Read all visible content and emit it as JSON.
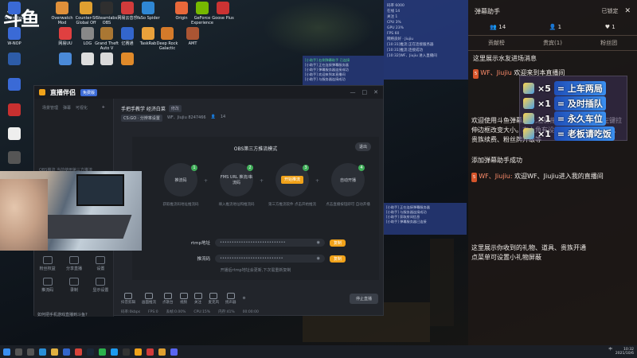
{
  "logo": "斗鱼",
  "desktop_icons": [
    {
      "label": "Unlimited",
      "color": "#3a6ad6"
    },
    {
      "label": "Overwatch Mod",
      "color": "#e0903a"
    },
    {
      "label": "Counter-St Global Off",
      "color": "#e0a030"
    },
    {
      "label": "Steamlabs OBS",
      "color": "#2f2f2f"
    },
    {
      "label": "网易云音乐",
      "color": "#d23b3b"
    },
    {
      "label": "YaSo Spider",
      "color": "#2f87d4"
    },
    {
      "label": "Origin",
      "color": "#e8683a"
    },
    {
      "label": "GeForce Experience",
      "color": "#76b900"
    },
    {
      "label": "Goose Plus",
      "color": "#c33"
    },
    {
      "label": "WEGAME",
      "color": "#2d5ca8"
    },
    {
      "label": "W-NOP",
      "color": "#3a6ad6"
    },
    {
      "label": "网易UU",
      "color": "#e04040"
    },
    {
      "label": "LOG",
      "color": "#888"
    },
    {
      "label": "Grand Theft Auto V",
      "color": "#aa7733"
    },
    {
      "label": "亿赛通",
      "color": "#3366cc"
    },
    {
      "label": "TaskRab",
      "color": "#e9a13b"
    },
    {
      "label": "Deep Rock Galactic",
      "color": "#d47a2a"
    },
    {
      "label": "AMT",
      "color": "#aa5533"
    }
  ],
  "app": {
    "title": "直播伴侣",
    "badge": "免费版",
    "win_controls": [
      "—",
      "□",
      "✕"
    ],
    "left_tabs": [
      "场景管理",
      "弹幕",
      "可视化"
    ],
    "left_plus": "+",
    "left_empty": "OBS推流 当前使用第三方推流",
    "left_grid": [
      "粉丝权益",
      "分享直播",
      "设置",
      "推流码",
      "录制",
      "显示设置",
      "弹幕助手",
      "连麦",
      "任务"
    ],
    "left_note": "如何把手机游戏直播到斗鱼?",
    "stream_title": "手把手教学 经济白菜",
    "stream_edit": "修改",
    "stream_cat": "CS:GO · 分辨率设置",
    "stream_author": "WF、Jiujiu 8247466",
    "stream_viewers": "14",
    "mode_title": "OBS第三方推流模式",
    "exit": "退出",
    "steps": [
      {
        "num": "1",
        "label": "推流码",
        "cap": "获取推流码地址推流码"
      },
      {
        "num": "2",
        "label": "FMS URL 推流/串流码",
        "cap": "填入推流地址和推流码"
      },
      {
        "num": "3",
        "label": "开始推流",
        "cap": "第三方推流软件 点击开始推流"
      },
      {
        "num": "4",
        "label": "自动开播",
        "cap": "点击直播按钮即可 自动开播"
      }
    ],
    "rtmp_label": "rtmp地址",
    "rtmp_value": "••••••••••••••••••••••••••••",
    "key_label": "推流码",
    "key_value": "•••••••••••••••••••••••••••",
    "copy": "复制",
    "hint": "开播后rtmp地址会更新,下次需重新复制",
    "toolbar": [
      "抖音剪辑",
      "画面推流",
      "点歌台",
      "视频",
      "关注",
      "语音",
      "麦克风",
      "扬声器"
    ],
    "start_live": "停止直播",
    "status": [
      "码率:0kbps",
      "FPS:0",
      "丢帧:0.00%",
      "CPU:15%",
      "内存:41%",
      "00:00:00"
    ]
  },
  "stats": [
    "码率 6000",
    "在线 14",
    "关注 1",
    "CPU 3%",
    "GPU 23%",
    "FPS 60",
    "网络良好 · Jiujiu",
    "[10:31]推流:正在连接服务器",
    "[10:31]推流:连接成功",
    "[10:32]WF、Jiujiu 进入直播间"
  ],
  "log1": [
    "[小助手] 右侧弹幕助手 已连接",
    "[小助手] 正在连接弹幕服务器",
    "[小助手] 弹幕服务器连接成功",
    "[小助手] 欢迎来到本直播间",
    "[小助手] 与服务器连接成功"
  ],
  "log2": [
    "[小助手] 正在连接弹幕服务器",
    "[小助手] 与服务器连接成功",
    "[小助手] 获取房间信息",
    "[小助手] 弹幕服务器已连接"
  ],
  "danmu": {
    "title": "弹幕助手",
    "lock": "已锁定",
    "close": "✕",
    "stats": [
      "14",
      "1",
      "1"
    ],
    "tabs": [
      "贡献榜",
      "贵宾(1)",
      "粉丝团"
    ],
    "msg1": "这里展示水友进场消息",
    "msg2_name": "WF、Jiujiu",
    "msg2_text": "欢迎来到本直播间",
    "msg3": "欢迎使用斗鱼弹幕助手,左键拖拽顶部改变位置,左键拉伸边框改变大小。右上角有设置菜单,这里展示弹幕、贵族续费、粉丝牌升级等",
    "msg3b": "添加弹幕助手成功",
    "msg4_name": "WF、Jiujiu:",
    "msg4_text": "欢迎WF、Jiujiu进入我的直播间",
    "msg5": "这里展示你收到的礼物、道具、贵族开通",
    "msg5b": "点菜单可设置小礼物屏蔽"
  },
  "gifts": [
    {
      "mult": "×5",
      "text": "= 上车两局"
    },
    {
      "mult": "×1",
      "text": "= 及时插队"
    },
    {
      "mult": "×1",
      "text": "= 永久车位"
    },
    {
      "mult": "×1",
      "text": "= 老板请吃饭"
    }
  ],
  "taskbar": {
    "time": "10:32",
    "date": "2021/10/6",
    "lang": "中"
  }
}
